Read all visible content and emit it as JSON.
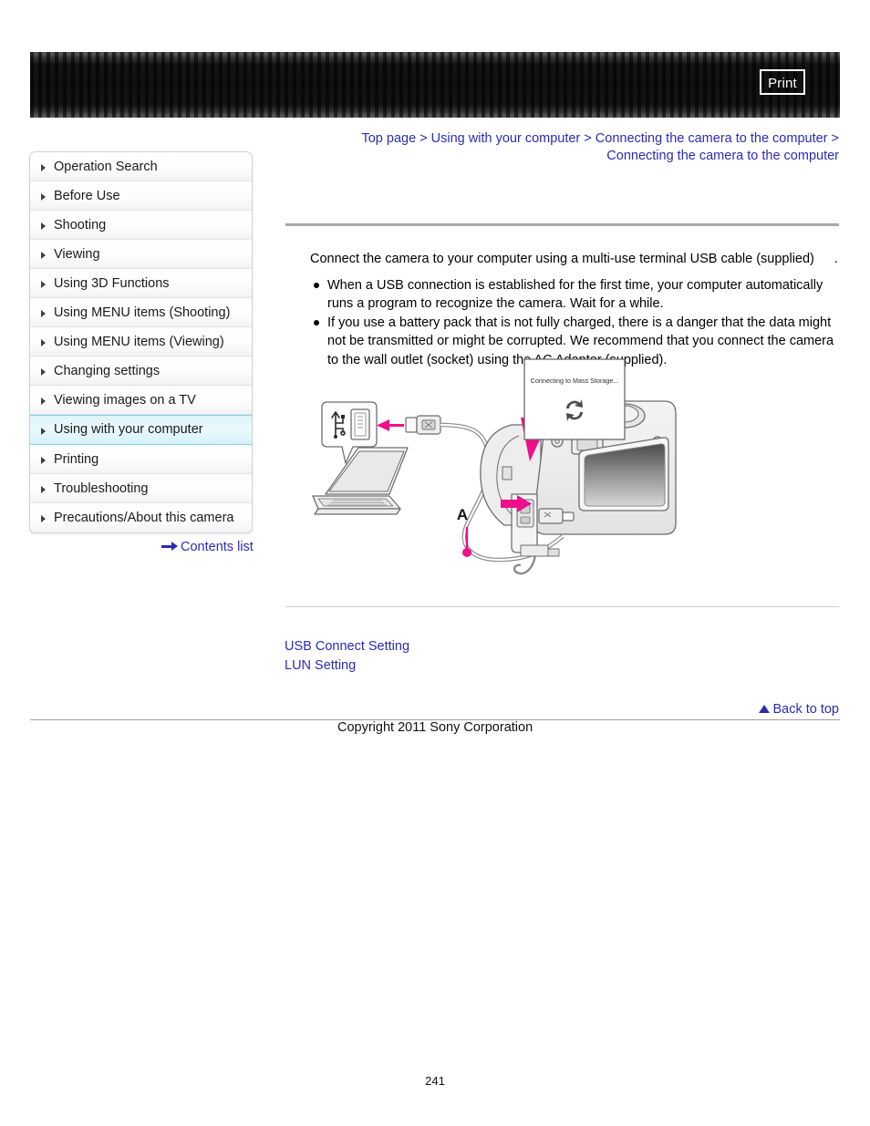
{
  "header": {
    "print_label": "Print"
  },
  "sidebar": {
    "items": [
      {
        "label": "Operation Search",
        "active": false
      },
      {
        "label": "Before Use",
        "active": false
      },
      {
        "label": "Shooting",
        "active": false
      },
      {
        "label": "Viewing",
        "active": false
      },
      {
        "label": "Using 3D Functions",
        "active": false
      },
      {
        "label": "Using MENU items (Shooting)",
        "active": false
      },
      {
        "label": "Using MENU items (Viewing)",
        "active": false
      },
      {
        "label": "Changing settings",
        "active": false
      },
      {
        "label": "Viewing images on a TV",
        "active": false
      },
      {
        "label": "Using with your computer",
        "active": true
      },
      {
        "label": "Printing",
        "active": false
      },
      {
        "label": "Troubleshooting",
        "active": false
      },
      {
        "label": "Precautions/About this camera",
        "active": false
      }
    ],
    "contents_list_label": "Contents list"
  },
  "breadcrumb": {
    "crumbs": [
      "Top page",
      "Using with your computer",
      "Connecting the camera to the computer",
      "Connecting the camera to the computer"
    ],
    "separator": ">"
  },
  "main": {
    "intro": "Connect the camera to your computer using a multi-use terminal USB cable (supplied)",
    "intro_trailing": ".",
    "bullets": [
      "When a USB connection is established for the first time, your computer automatically runs a program to recognize the camera. Wait for a while.",
      "If you use a battery pack that is not fully charged, there is a danger that the data might not be transmitted or might be corrupted. We recommend that you connect the camera to the wall outlet (socket) using the AC Adaptor (supplied)."
    ],
    "links": [
      "USB Connect Setting",
      "LUN Setting"
    ]
  },
  "figure": {
    "cable_label": "A",
    "screen_message": "Connecting to Mass Storage...",
    "accent_color": "#ee0f8c",
    "line_color": "#6d6d6d"
  },
  "footer": {
    "back_to_top_label": "Back to top",
    "copyright": "Copyright 2011 Sony Corporation",
    "page_number": "241"
  }
}
